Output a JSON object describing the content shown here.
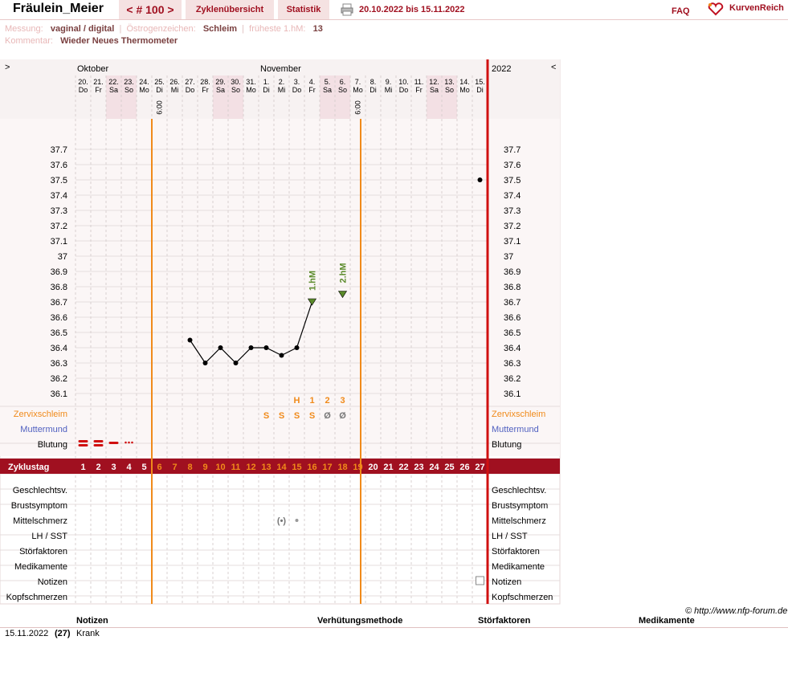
{
  "header": {
    "user": "Fräulein_Meier",
    "cycle_nav": "< # 100 >",
    "tab_overview": "Zyklenübersicht",
    "tab_stats": "Statistik",
    "date_range": "20.10.2022 bis 15.11.2022",
    "faq": "FAQ",
    "brand": "KurvenReich",
    "print_icon": "printer-icon",
    "brand_icon": "heart-logo-icon"
  },
  "info": {
    "messung_label": "Messung:",
    "messung_value": "vaginal / digital",
    "oestrogen_label": "Östrogenzeichen:",
    "oestrogen_value": "Schleim",
    "fruehest_label": "früheste 1.hM:",
    "fruehest_value": "13",
    "kommentar_label": "Kommentar:",
    "kommentar_value": "Wieder Neues Thermometer"
  },
  "chart": {
    "nav_left": ">",
    "nav_right": "<",
    "month_oct": "Oktober",
    "month_nov": "November",
    "year": "2022",
    "days": [
      {
        "d": "20.",
        "w": "Do",
        "we": false
      },
      {
        "d": "21.",
        "w": "Fr",
        "we": false
      },
      {
        "d": "22.",
        "w": "Sa",
        "we": true
      },
      {
        "d": "23.",
        "w": "So",
        "we": true
      },
      {
        "d": "24.",
        "w": "Mo",
        "we": false
      },
      {
        "d": "25.",
        "w": "Di",
        "we": false
      },
      {
        "d": "26.",
        "w": "Mi",
        "we": false
      },
      {
        "d": "27.",
        "w": "Do",
        "we": false
      },
      {
        "d": "28.",
        "w": "Fr",
        "we": false
      },
      {
        "d": "29.",
        "w": "Sa",
        "we": true
      },
      {
        "d": "30.",
        "w": "So",
        "we": true
      },
      {
        "d": "31.",
        "w": "Mo",
        "we": false
      },
      {
        "d": "1.",
        "w": "Di",
        "we": false
      },
      {
        "d": "2.",
        "w": "Mi",
        "we": false
      },
      {
        "d": "3.",
        "w": "Do",
        "we": false
      },
      {
        "d": "4.",
        "w": "Fr",
        "we": false
      },
      {
        "d": "5.",
        "w": "Sa",
        "we": true
      },
      {
        "d": "6.",
        "w": "So",
        "we": true
      },
      {
        "d": "7.",
        "w": "Mo",
        "we": false
      },
      {
        "d": "8.",
        "w": "Di",
        "we": false
      },
      {
        "d": "9.",
        "w": "Mi",
        "we": false
      },
      {
        "d": "10.",
        "w": "Do",
        "we": false
      },
      {
        "d": "11.",
        "w": "Fr",
        "we": false
      },
      {
        "d": "12.",
        "w": "Sa",
        "we": true
      },
      {
        "d": "13.",
        "w": "So",
        "we": true
      },
      {
        "d": "14.",
        "w": "Mo",
        "we": false
      },
      {
        "d": "15.",
        "w": "Di",
        "we": false
      }
    ],
    "time_marks": [
      {
        "day_index": 5,
        "text": "6:00"
      },
      {
        "day_index": 18,
        "text": "6:00"
      }
    ],
    "y_ticks": [
      "37.7",
      "37.6",
      "37.5",
      "37.4",
      "37.3",
      "37.2",
      "37.1",
      "37",
      "36.9",
      "36.8",
      "36.7",
      "36.6",
      "36.5",
      "36.4",
      "36.3",
      "36.2",
      "36.1"
    ],
    "row_labels": [
      "Zervixschleim",
      "Muttermund",
      "Blutung"
    ],
    "cycle_label": "Zyklustag",
    "cycle_days": [
      "1",
      "2",
      "3",
      "4",
      "5",
      "6",
      "7",
      "8",
      "9",
      "10",
      "11",
      "12",
      "13",
      "14",
      "15",
      "16",
      "17",
      "18",
      "19",
      "20",
      "21",
      "22",
      "23",
      "24",
      "25",
      "26",
      "27"
    ],
    "bottom_labels": [
      "Geschlechtsv.",
      "Brustsymptom",
      "Mittelschmerz",
      "LH / SST",
      "Störfaktoren",
      "Medikamente",
      "Notizen",
      "Kopfschmerzen"
    ],
    "hm_labels": [
      "1.hM",
      "2.hM"
    ],
    "peak_labels": [
      "H",
      "1",
      "2",
      "3"
    ],
    "mucus_marks": [
      "S",
      "S",
      "S",
      "S",
      "Ø",
      "Ø"
    ],
    "colors": {
      "accent": "#a01020",
      "orange": "#f08a1a",
      "green": "#5a8a2a",
      "blue": "#5060c0",
      "weekend": "#f3e0e4",
      "grid": "#d8d8d8"
    }
  },
  "chart_data": {
    "type": "line",
    "x": [
      "20.10.",
      "21.10.",
      "22.10.",
      "23.10.",
      "24.10.",
      "25.10.",
      "26.10.",
      "27.10.",
      "28.10.",
      "29.10.",
      "30.10.",
      "31.10.",
      "1.11.",
      "2.11.",
      "3.11.",
      "4.11.",
      "5.11.",
      "6.11.",
      "7.11.",
      "8.11.",
      "9.11.",
      "10.11.",
      "11.11.",
      "12.11.",
      "13.11.",
      "14.11.",
      "15.11."
    ],
    "series": [
      {
        "values": [
          null,
          null,
          null,
          null,
          null,
          null,
          null,
          36.45,
          36.3,
          36.4,
          36.3,
          36.4,
          36.4,
          36.35,
          36.4,
          36.7,
          null,
          36.75,
          null,
          null,
          null,
          null,
          null,
          null,
          null,
          null,
          37.5
        ]
      }
    ],
    "ylim": [
      36.0,
      37.8
    ],
    "grid": true
  },
  "notes": {
    "col_notizen": "Notizen",
    "col_verhuetung": "Verhütungsmethode",
    "col_stoer": "Störfaktoren",
    "col_medi": "Medikamente",
    "row_date": "15.11.2022",
    "row_day": "(27)",
    "row_note": "Krank"
  },
  "credit": "© http://www.nfp-forum.de"
}
